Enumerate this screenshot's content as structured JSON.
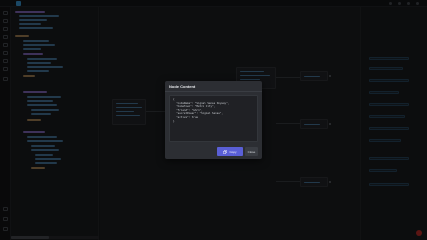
{
  "modal": {
    "title": "Node Content",
    "content": "{\n  \"nodeName\": \"Signal Sense Skyway\",\n  \"homeTown\": \"Metro City\",\n  \"friend\": \"Ghrn\",\n  \"secretPower\": \"Signal Sense\",\n  \"active\": true\n}",
    "copy_label": "Copy",
    "close_label": "Close"
  },
  "colors": {
    "accent": "#5a5fd6",
    "logo": "#3d9fe0",
    "record": "#c9302c"
  },
  "icons": {
    "copy": "copy-icon",
    "logo": "logo-icon"
  }
}
